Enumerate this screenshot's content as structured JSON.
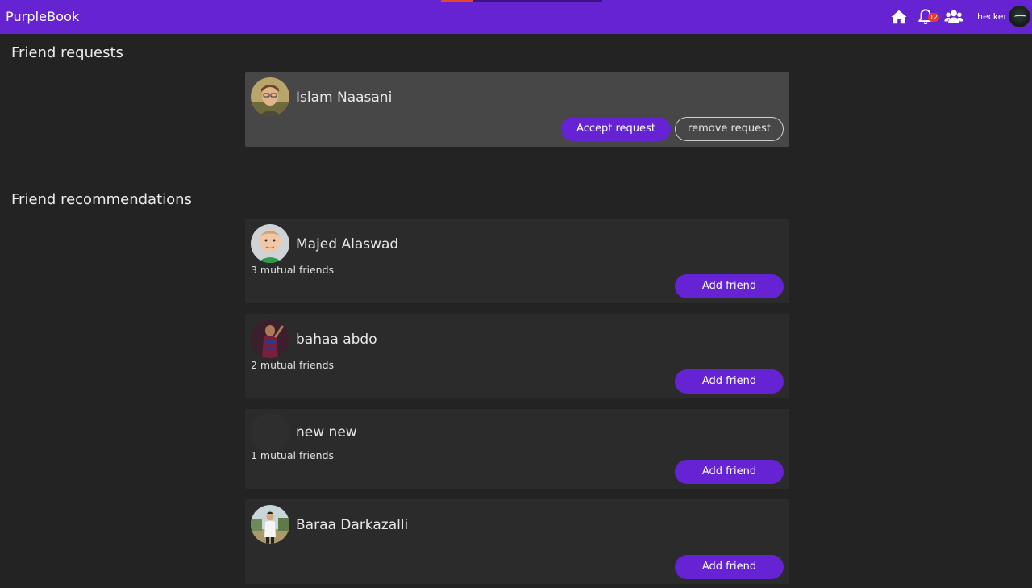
{
  "app": {
    "brand": "PurpleBook",
    "brand_color": "#6623d2"
  },
  "nav": {
    "icons": [
      "home-icon",
      "bell-icon",
      "friends-icon"
    ],
    "notification_count": "12",
    "username": "hecker"
  },
  "friend_requests": {
    "title": "Friend requests",
    "items": [
      {
        "name": "Islam Naasani",
        "accept_label": "Accept request",
        "remove_label": "remove request"
      }
    ]
  },
  "recommendations": {
    "title": "Friend recommendations",
    "items": [
      {
        "name": "Majed Alaswad",
        "mutual": "3 mutual friends",
        "button_label": "Add friend"
      },
      {
        "name": "bahaa abdo",
        "mutual": "2 mutual friends",
        "button_label": "Add friend"
      },
      {
        "name": "new new",
        "mutual": "1 mutual friends",
        "button_label": "Add friend"
      },
      {
        "name": "Baraa Darkazalli",
        "mutual": "",
        "button_label": "Add friend"
      }
    ]
  }
}
